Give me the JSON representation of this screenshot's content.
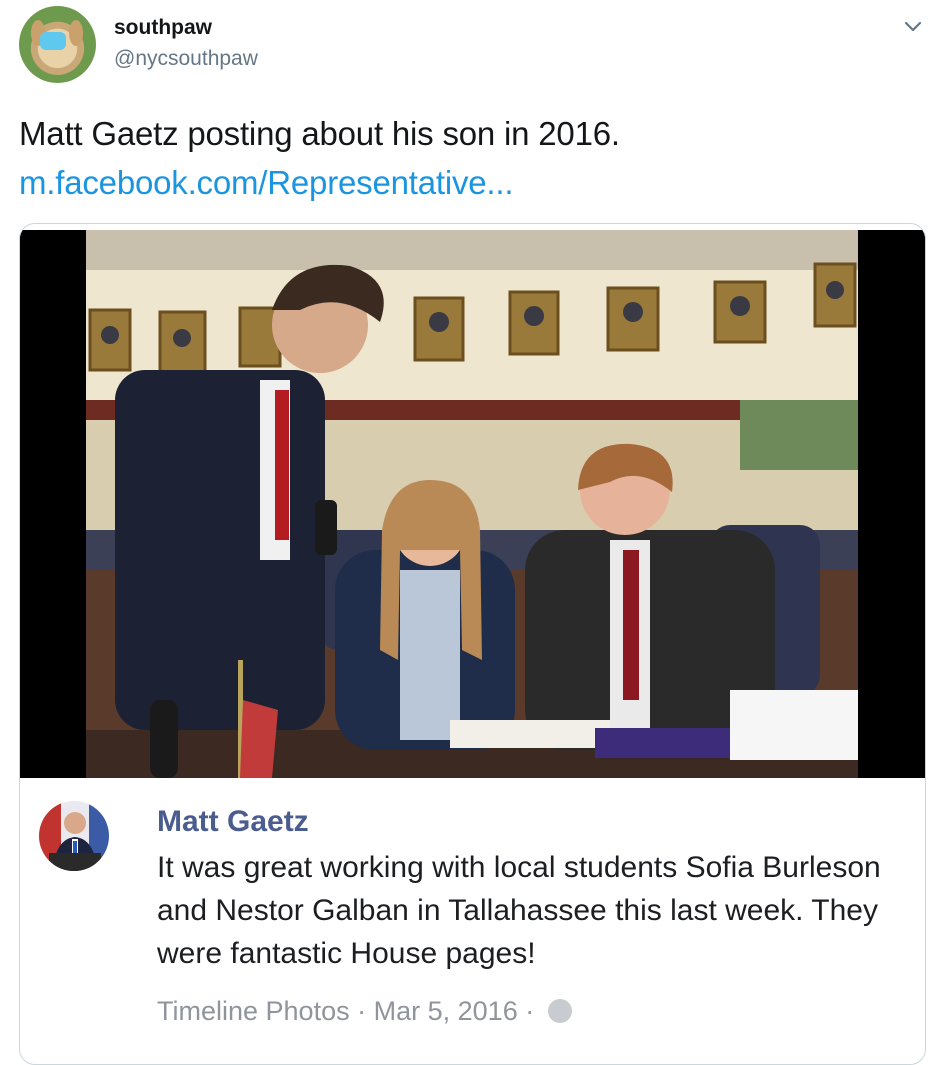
{
  "tweet": {
    "display_name": "southpaw",
    "handle": "@nycsouthpaw",
    "text": "Matt Gaetz posting about his son in 2016.",
    "link_text": "m.facebook.com/Representative...",
    "avatar_icon": "golden-retriever-puppy-with-mask",
    "menu_icon": "chevron-down-icon"
  },
  "card": {
    "photo": "photo of three young people at a legislative chamber desk",
    "author": "Matt Gaetz",
    "post_text": "It was great working with local students Sofia Burleson and Nestor Galban in Tallahassee this last week. They were fantastic House pages!",
    "meta_source": "Timeline Photos",
    "meta_separator": "·",
    "meta_date": "Mar 5, 2016",
    "meta_icon": "globe-icon"
  },
  "colors": {
    "link": "#1b95e0",
    "name": "#14171a",
    "secondary": "#657786",
    "fb_name": "#4b5d8e",
    "border": "#ccd6dd"
  }
}
